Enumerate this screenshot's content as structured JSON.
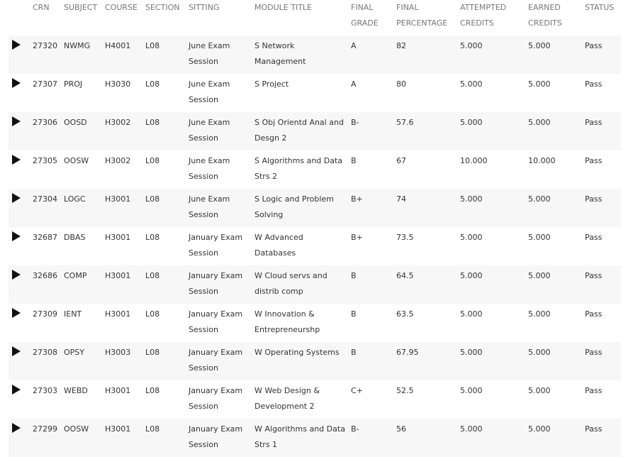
{
  "columns": {
    "crn": "CRN",
    "subject": "SUBJECT",
    "course": "COURSE",
    "section": "SECTION",
    "sitting": "SITTING",
    "module_title": "MODULE TITLE",
    "final_grade": "FINAL GRADE",
    "final_percentage": "FINAL PERCENTAGE",
    "attempted_credits": "ATTEMPTED CREDITS",
    "earned_credits": "EARNED CREDITS",
    "status": "STATUS"
  },
  "rows": [
    {
      "crn": "27320",
      "subject": "NWMG",
      "course": "H4001",
      "section": "L08",
      "sitting": "June Exam Session",
      "module_title": "S Network Management",
      "final_grade": "A",
      "final_percentage": "82",
      "attempted_credits": "5.000",
      "earned_credits": "5.000",
      "status": "Pass"
    },
    {
      "crn": "27307",
      "subject": "PROJ",
      "course": "H3030",
      "section": "L08",
      "sitting": "June Exam Session",
      "module_title": "S Project",
      "final_grade": "A",
      "final_percentage": "80",
      "attempted_credits": "5.000",
      "earned_credits": "5.000",
      "status": "Pass"
    },
    {
      "crn": "27306",
      "subject": "OOSD",
      "course": "H3002",
      "section": "L08",
      "sitting": "June Exam Session",
      "module_title": "S Obj Orientd Anal and Desgn 2",
      "final_grade": "B-",
      "final_percentage": "57.6",
      "attempted_credits": "5.000",
      "earned_credits": "5.000",
      "status": "Pass"
    },
    {
      "crn": "27305",
      "subject": "OOSW",
      "course": "H3002",
      "section": "L08",
      "sitting": "June Exam Session",
      "module_title": "S Algorithms and Data Strs 2",
      "final_grade": "B",
      "final_percentage": "67",
      "attempted_credits": "10.000",
      "earned_credits": "10.000",
      "status": "Pass"
    },
    {
      "crn": "27304",
      "subject": "LOGC",
      "course": "H3001",
      "section": "L08",
      "sitting": "June Exam Session",
      "module_title": "S Logic and Problem Solving",
      "final_grade": "B+",
      "final_percentage": "74",
      "attempted_credits": "5.000",
      "earned_credits": "5.000",
      "status": "Pass"
    },
    {
      "crn": "32687",
      "subject": "DBAS",
      "course": "H3001",
      "section": "L08",
      "sitting": "January Exam Session",
      "module_title": "W Advanced Databases",
      "final_grade": "B+",
      "final_percentage": "73.5",
      "attempted_credits": "5.000",
      "earned_credits": "5.000",
      "status": "Pass"
    },
    {
      "crn": "32686",
      "subject": "COMP",
      "course": "H3001",
      "section": "L08",
      "sitting": "January Exam Session",
      "module_title": "W Cloud servs and distrib comp",
      "final_grade": "B",
      "final_percentage": "64.5",
      "attempted_credits": "5.000",
      "earned_credits": "5.000",
      "status": "Pass"
    },
    {
      "crn": "27309",
      "subject": "IENT",
      "course": "H3001",
      "section": "L08",
      "sitting": "January Exam Session",
      "module_title": "W Innovation & Entrepreneurshp",
      "final_grade": "B",
      "final_percentage": "63.5",
      "attempted_credits": "5.000",
      "earned_credits": "5.000",
      "status": "Pass"
    },
    {
      "crn": "27308",
      "subject": "OPSY",
      "course": "H3003",
      "section": "L08",
      "sitting": "January Exam Session",
      "module_title": "W Operating Systems",
      "final_grade": "B",
      "final_percentage": "67.95",
      "attempted_credits": "5.000",
      "earned_credits": "5.000",
      "status": "Pass"
    },
    {
      "crn": "27303",
      "subject": "WEBD",
      "course": "H3001",
      "section": "L08",
      "sitting": "January Exam Session",
      "module_title": "W Web Design & Development 2",
      "final_grade": "C+",
      "final_percentage": "52.5",
      "attempted_credits": "5.000",
      "earned_credits": "5.000",
      "status": "Pass"
    },
    {
      "crn": "27299",
      "subject": "OOSW",
      "course": "H3001",
      "section": "L08",
      "sitting": "January Exam Session",
      "module_title": "W Algorithms and Data Strs 1",
      "final_grade": "B-",
      "final_percentage": "56",
      "attempted_credits": "5.000",
      "earned_credits": "5.000",
      "status": "Pass"
    }
  ]
}
